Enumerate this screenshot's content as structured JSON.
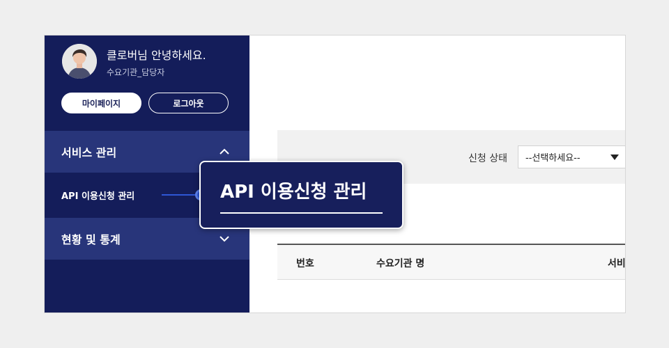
{
  "user": {
    "greeting": "클로버님 안녕하세요.",
    "role": "수요기관_담당자"
  },
  "account_buttons": {
    "mypage": "마이페이지",
    "logout": "로그아웃"
  },
  "sidebar": {
    "groups": [
      {
        "label": "서비스 관리",
        "expanded": true,
        "items": [
          {
            "label": "API 이용신청 관리"
          }
        ]
      },
      {
        "label": "현황 및 통계",
        "expanded": false,
        "items": []
      }
    ]
  },
  "search": {
    "status_label": "신청 상태",
    "status_select": "--선택하세요--"
  },
  "table": {
    "headers": [
      "번호",
      "수요기관 명",
      "서비"
    ]
  },
  "callout": {
    "text": "API 이용신청 관리"
  },
  "colors": {
    "sidebar_bg": "#141d5a",
    "menu_group_bg": "#28357a",
    "accent_dot": "#2f57d6"
  }
}
